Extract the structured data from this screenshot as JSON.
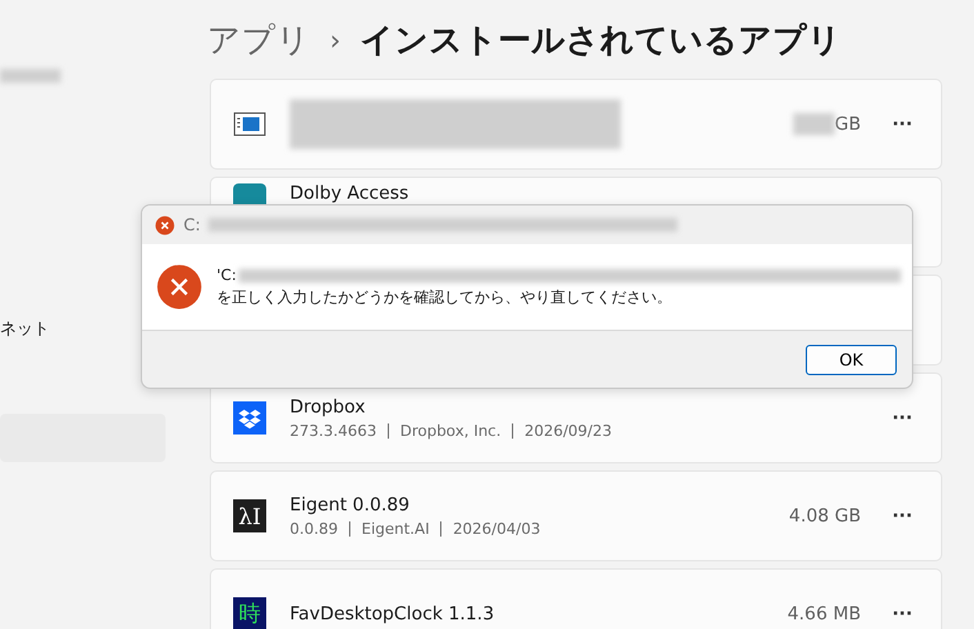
{
  "sidebar": {
    "items": [
      {
        "label": "ネット"
      }
    ]
  },
  "breadcrumb": {
    "parent": "アプリ",
    "separator": "›",
    "current": "インストールされているアプリ"
  },
  "apps": [
    {
      "kind": "window",
      "redacted": true,
      "size": "GB"
    },
    {
      "kind": "dolby",
      "name": "Dolby Access"
    },
    {
      "kind": "hidden"
    },
    {
      "kind": "dropbox",
      "name": "Dropbox",
      "version": "273.3.4663",
      "publisher": "Dropbox, Inc.",
      "date": "2026/09/23"
    },
    {
      "kind": "text",
      "icon_text": "λI",
      "name": "Eigent 0.0.89",
      "version": "0.0.89",
      "publisher": "Eigent.AI",
      "date": "2026/04/03",
      "size": "4.08 GB"
    },
    {
      "kind": "text_green",
      "icon_text": "時",
      "name": "FavDesktopClock 1.1.3",
      "size": "4.66 MB"
    }
  ],
  "more_label": "···",
  "dialog": {
    "title": "C:",
    "message_start": "'C:",
    "message_end": "を正しく入力したかどうかを確認してから、やり直してください。",
    "button": "OK"
  }
}
